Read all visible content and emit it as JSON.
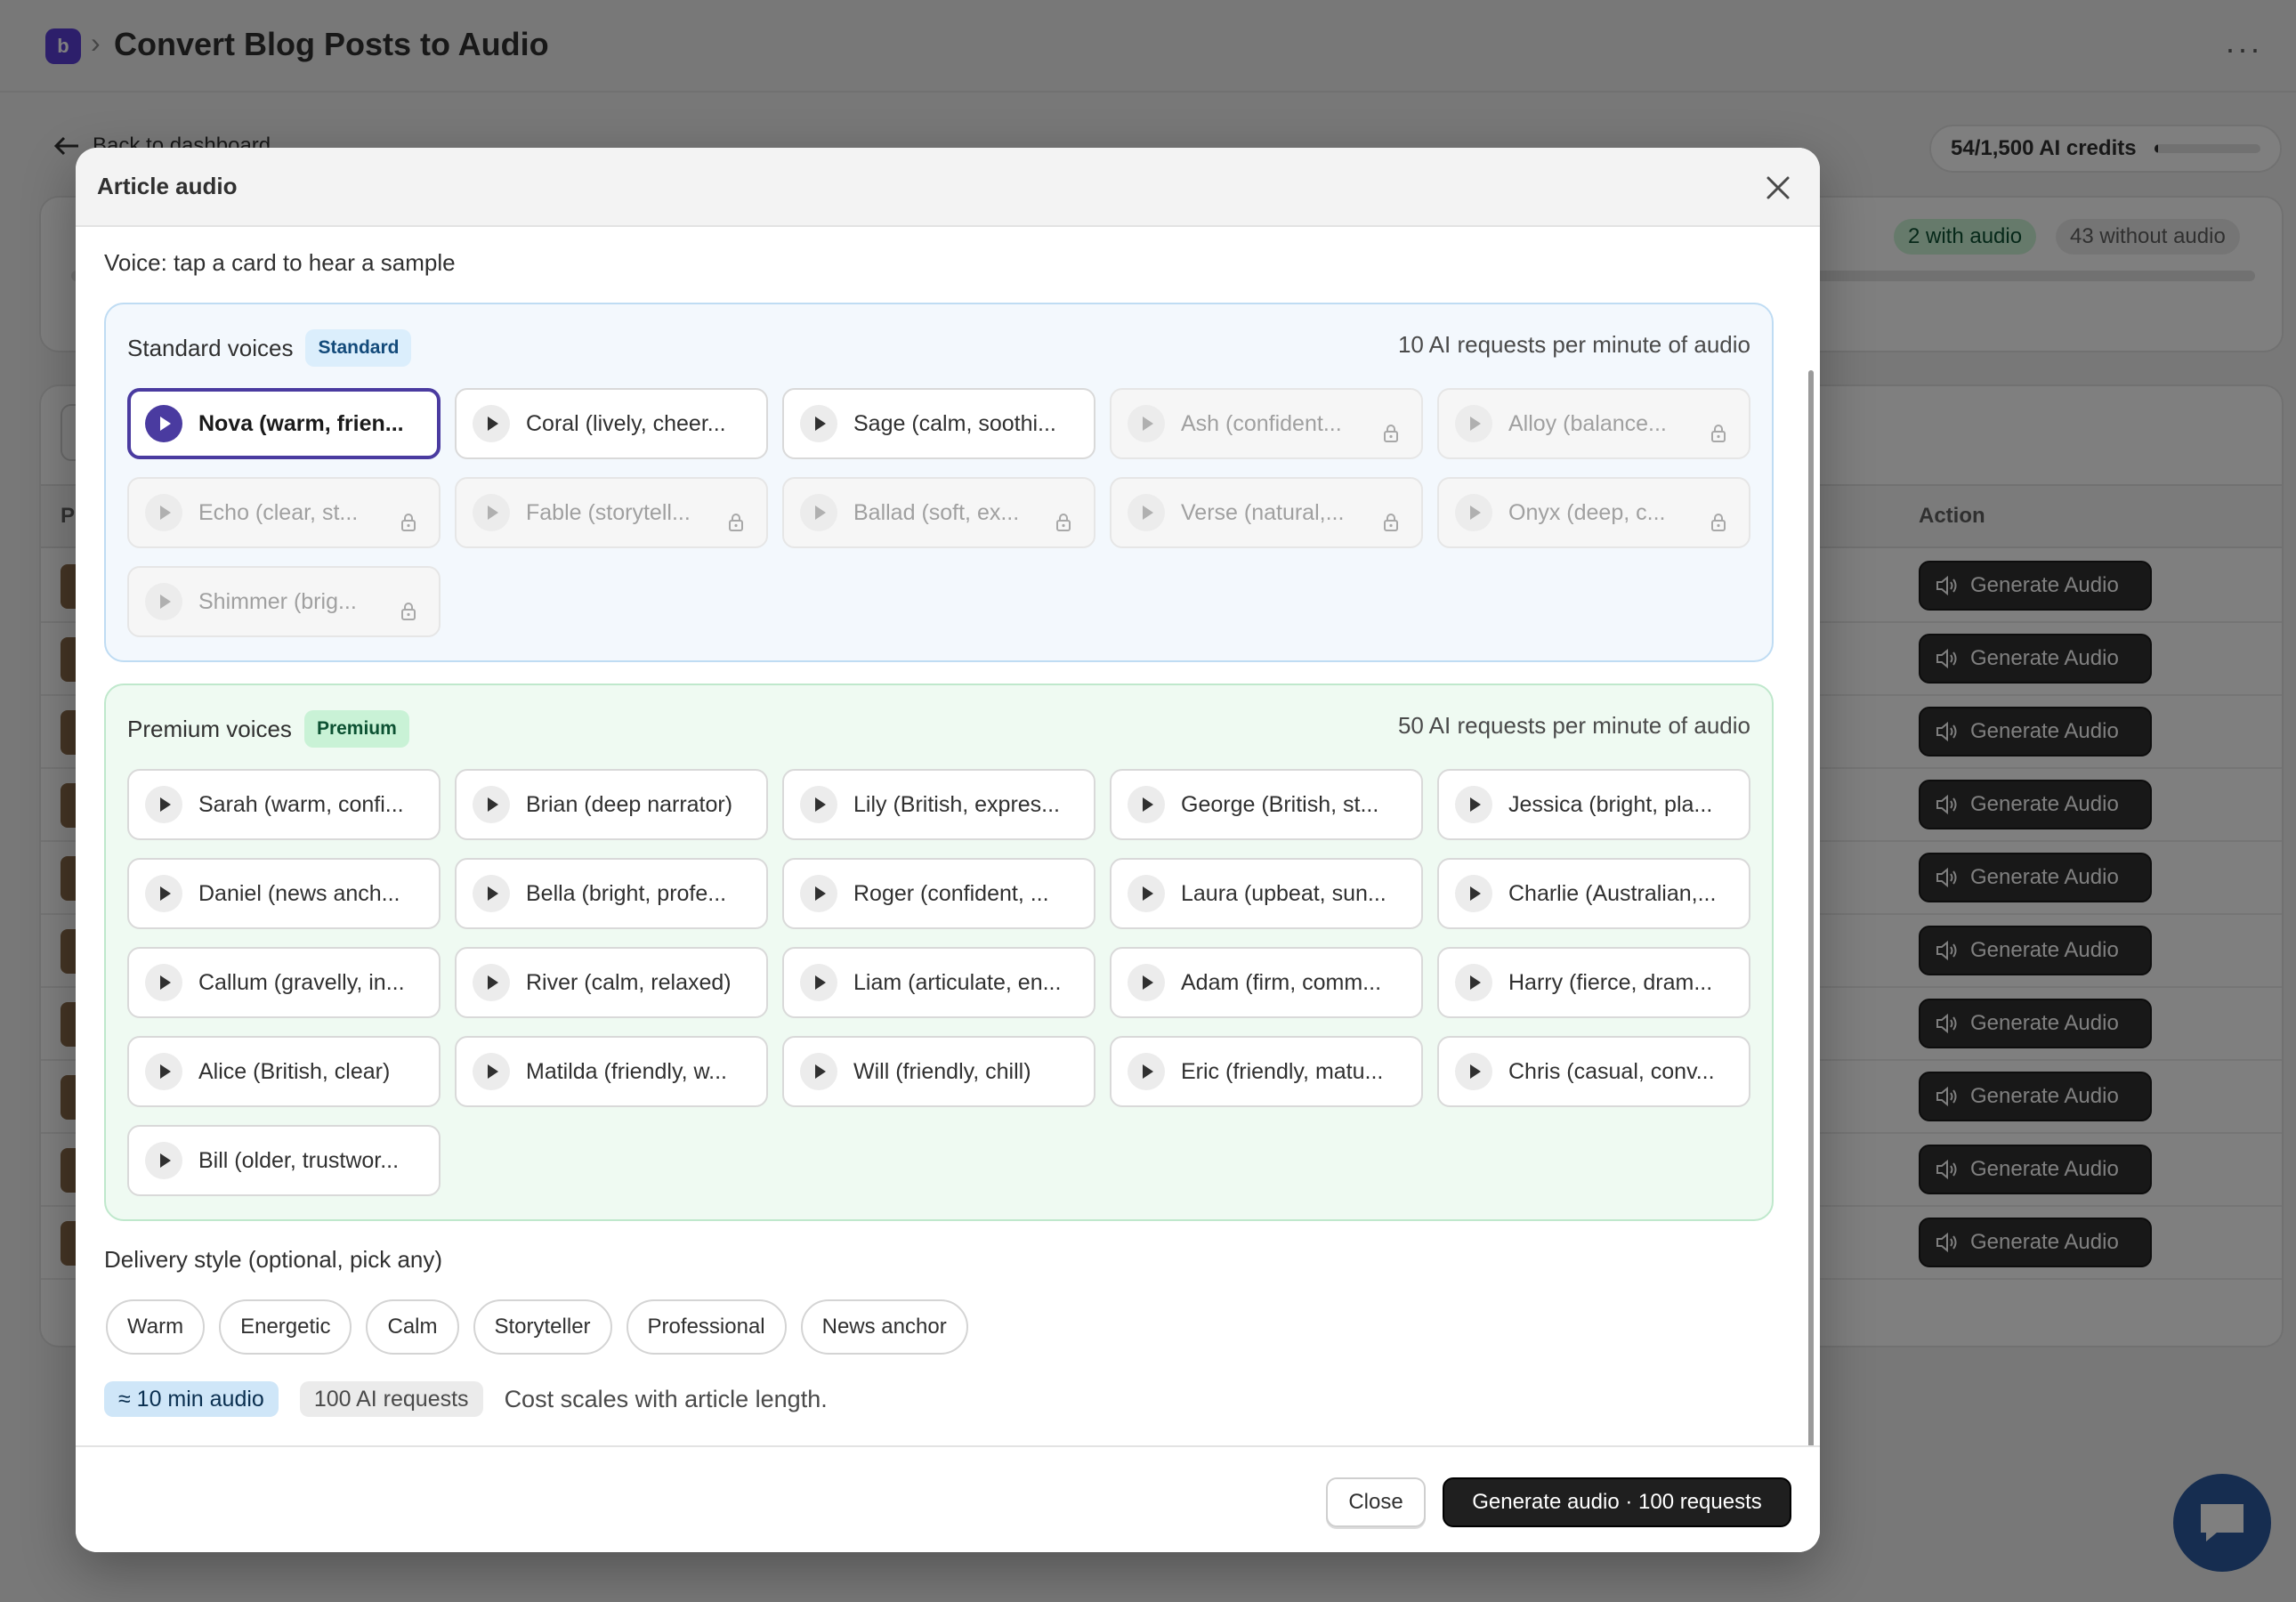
{
  "app": {
    "title": "Convert Blog Posts to Audio",
    "back_label": "Back to dashboard",
    "credits_label": "54/1,500 AI credits",
    "credits_fraction": 0.036,
    "with_audio": "2 with audio",
    "without_audio": "43 without audio",
    "table_col_product": "P",
    "table_col_action": "Action",
    "generate_audio_label": "Generate Audio",
    "row_count": 10
  },
  "modal": {
    "title": "Article audio",
    "voice_prompt": "Voice: tap a card to hear a sample",
    "standard": {
      "title": "Standard voices",
      "badge": "Standard",
      "rate": "10 AI requests per minute of audio",
      "voices": [
        {
          "name": "Nova (warm, frien...",
          "selected": true,
          "locked": false
        },
        {
          "name": "Coral (lively, cheer...",
          "selected": false,
          "locked": false
        },
        {
          "name": "Sage (calm, soothi...",
          "selected": false,
          "locked": false
        },
        {
          "name": "Ash (confident...",
          "selected": false,
          "locked": true
        },
        {
          "name": "Alloy (balance...",
          "selected": false,
          "locked": true
        },
        {
          "name": "Echo (clear, st...",
          "selected": false,
          "locked": true
        },
        {
          "name": "Fable (storytell...",
          "selected": false,
          "locked": true
        },
        {
          "name": "Ballad (soft, ex...",
          "selected": false,
          "locked": true
        },
        {
          "name": "Verse (natural,...",
          "selected": false,
          "locked": true
        },
        {
          "name": "Onyx (deep, c...",
          "selected": false,
          "locked": true
        },
        {
          "name": "Shimmer (brig...",
          "selected": false,
          "locked": true
        }
      ]
    },
    "premium": {
      "title": "Premium voices",
      "badge": "Premium",
      "rate": "50 AI requests per minute of audio",
      "voices": [
        {
          "name": "Sarah (warm, confi..."
        },
        {
          "name": "Brian (deep narrator)"
        },
        {
          "name": "Lily (British, expres..."
        },
        {
          "name": "George (British, st..."
        },
        {
          "name": "Jessica (bright, pla..."
        },
        {
          "name": "Daniel (news anch..."
        },
        {
          "name": "Bella (bright, profe..."
        },
        {
          "name": "Roger (confident, ..."
        },
        {
          "name": "Laura (upbeat, sun..."
        },
        {
          "name": "Charlie (Australian,..."
        },
        {
          "name": "Callum (gravelly, in..."
        },
        {
          "name": "River (calm, relaxed)"
        },
        {
          "name": "Liam (articulate, en..."
        },
        {
          "name": "Adam (firm, comm..."
        },
        {
          "name": "Harry (fierce, dram..."
        },
        {
          "name": "Alice (British, clear)"
        },
        {
          "name": "Matilda (friendly, w..."
        },
        {
          "name": "Will (friendly, chill)"
        },
        {
          "name": "Eric (friendly, matu..."
        },
        {
          "name": "Chris (casual, conv..."
        },
        {
          "name": "Bill (older, trustwor..."
        }
      ]
    },
    "delivery_label": "Delivery style (optional, pick any)",
    "delivery_styles": [
      "Warm",
      "Energetic",
      "Calm",
      "Storyteller",
      "Professional",
      "News anchor"
    ],
    "duration": "≈ 10 min audio",
    "requests": "100 AI requests",
    "cost_note": "Cost scales with article length.",
    "close_label": "Close",
    "generate_label": "Generate audio · 100 requests"
  }
}
